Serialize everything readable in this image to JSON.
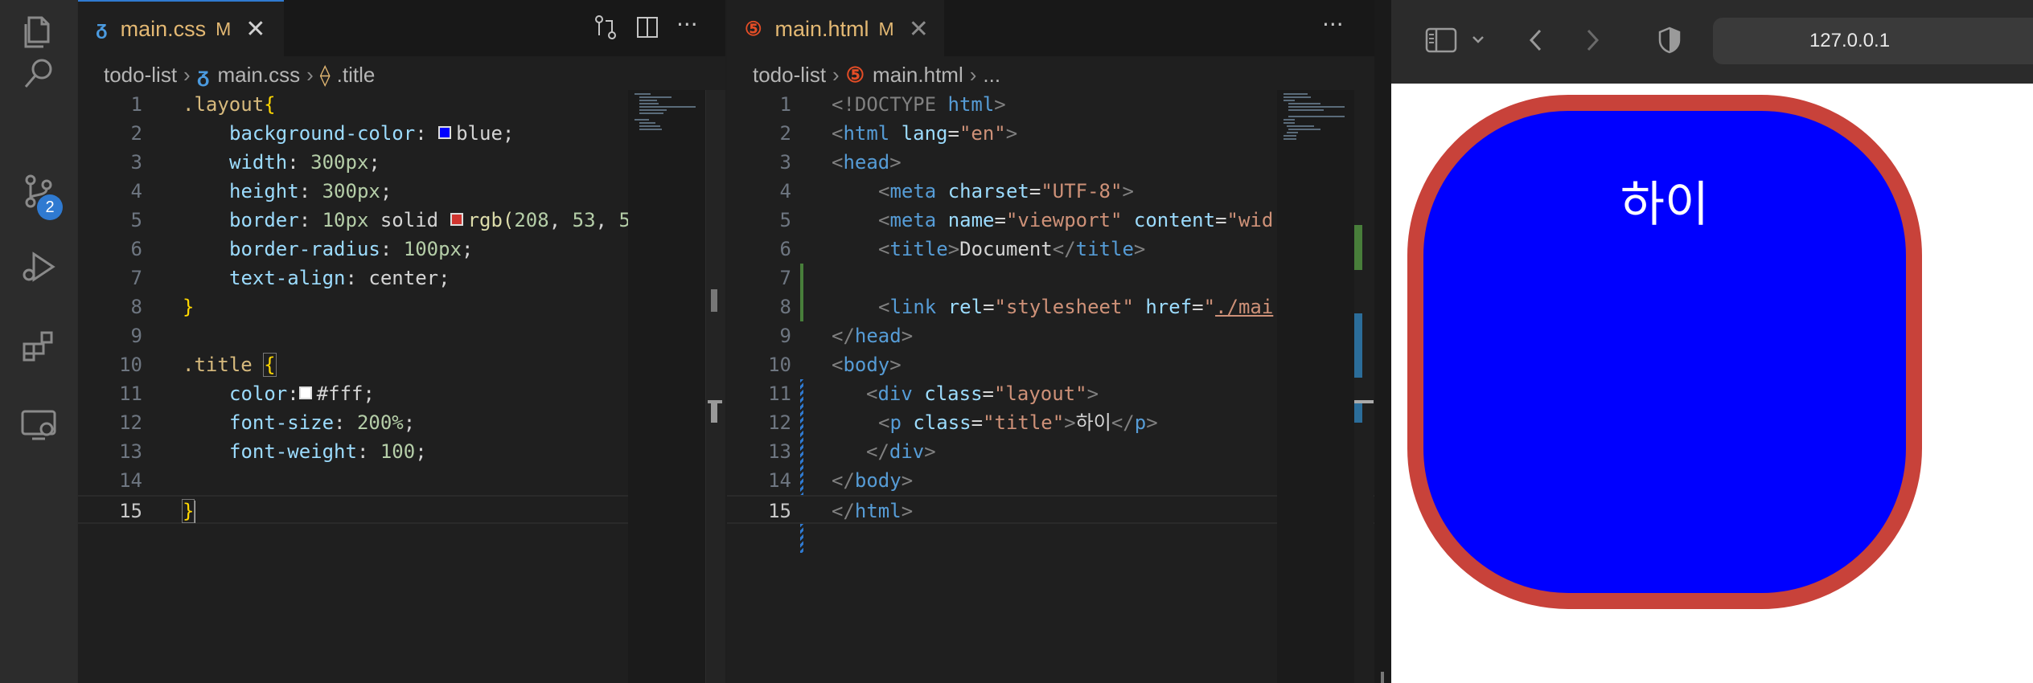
{
  "activity_bar": {
    "icons": [
      "explorer-icon",
      "search-icon",
      "source-control-icon",
      "run-debug-icon",
      "extensions-icon",
      "remote-explorer-icon"
    ],
    "source_control_badge": "2"
  },
  "editor_left": {
    "tab": {
      "name": "main.css",
      "modified": "M",
      "icon": "css-file-icon"
    },
    "breadcrumb": {
      "folder": "todo-list",
      "file": "main.css",
      "symbol": ".title"
    },
    "lines": [
      {
        "n": "1"
      },
      {
        "n": "2"
      },
      {
        "n": "3"
      },
      {
        "n": "4"
      },
      {
        "n": "5"
      },
      {
        "n": "6"
      },
      {
        "n": "7"
      },
      {
        "n": "8"
      },
      {
        "n": "9"
      },
      {
        "n": "10"
      },
      {
        "n": "11"
      },
      {
        "n": "12"
      },
      {
        "n": "13"
      },
      {
        "n": "14"
      },
      {
        "n": "15"
      }
    ],
    "code": {
      "l1": [
        ".layout",
        "{"
      ],
      "l2": [
        "background-color",
        ": ",
        "blue",
        ";"
      ],
      "l3": [
        "width",
        ": ",
        "300px",
        ";"
      ],
      "l4": [
        "height",
        ": ",
        "300px",
        ";"
      ],
      "l5": [
        "border",
        ": ",
        "10px",
        " solid ",
        "rgb(",
        "208",
        ", ",
        "53",
        ", ",
        "5"
      ],
      "l6": [
        "border-radius",
        ": ",
        "100px",
        ";"
      ],
      "l7": [
        "text-align",
        ": ",
        "center",
        ";"
      ],
      "l8": [
        "}"
      ],
      "l10": [
        ".title",
        " ",
        "{"
      ],
      "l11": [
        "color",
        ":",
        "#fff",
        ";"
      ],
      "l12": [
        "font-size",
        ": ",
        "200%",
        ";"
      ],
      "l13": [
        "font-weight",
        ": ",
        "100",
        ";"
      ],
      "l15": [
        "}"
      ]
    },
    "swatch_colors": {
      "blue": "#0000ff",
      "rgb": "#d03530",
      "white": "#ffffff"
    }
  },
  "editor_right": {
    "tab": {
      "name": "main.html",
      "modified": "M",
      "icon": "html-file-icon"
    },
    "breadcrumb": {
      "folder": "todo-list",
      "file": "main.html",
      "symbol": "..."
    },
    "code": {
      "l1": [
        "<!DOCTYPE ",
        "html",
        ">"
      ],
      "l2": [
        "<",
        "html",
        " ",
        "lang",
        "=",
        "\"en\"",
        ">"
      ],
      "l3": [
        "<",
        "head",
        ">"
      ],
      "l4": [
        "<",
        "meta",
        " ",
        "charset",
        "=",
        "\"UTF-8\"",
        ">"
      ],
      "l5": [
        "<",
        "meta",
        " ",
        "name",
        "=",
        "\"viewport\"",
        " ",
        "content",
        "=",
        "\"wid"
      ],
      "l6": [
        "<",
        "title",
        ">",
        "Document",
        "</",
        "title",
        ">"
      ],
      "l8": [
        "<",
        "link",
        " ",
        "rel",
        "=",
        "\"stylesheet\"",
        " ",
        "href",
        "=",
        "\"",
        "./mai"
      ],
      "l9": [
        "</",
        "head",
        ">"
      ],
      "l10": [
        "<",
        "body",
        ">"
      ],
      "l11": [
        "<",
        "div",
        " ",
        "class",
        "=",
        "\"layout\"",
        ">"
      ],
      "l12": [
        "<",
        "p",
        " ",
        "class",
        "=",
        "\"title\"",
        ">",
        "하이",
        "</",
        "p",
        ">"
      ],
      "l13": [
        "</",
        "div",
        ">"
      ],
      "l14": [
        "</",
        "body",
        ">"
      ],
      "l15": [
        "</",
        "html",
        ">"
      ]
    }
  },
  "browser": {
    "url": "127.0.0.1",
    "page_title_text": "하이",
    "colors": {
      "box_bg": "#0000ff",
      "box_border": "#c8423a",
      "text": "#ffffff"
    }
  }
}
